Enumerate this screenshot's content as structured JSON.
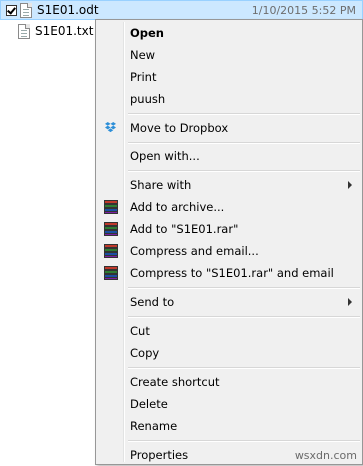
{
  "files": [
    {
      "name": "S1E01.odt",
      "date": "1/10/2015 5:52 PM",
      "selected": true
    },
    {
      "name": "S1E01.txt"
    }
  ],
  "menu": {
    "open": "Open",
    "new": "New",
    "print": "Print",
    "puush": "puush",
    "move_dropbox": "Move to Dropbox",
    "open_with": "Open with...",
    "share_with": "Share with",
    "add_archive": "Add to archive...",
    "add_rar": "Add to \"S1E01.rar\"",
    "compress_email": "Compress and email...",
    "compress_rar_email": "Compress to \"S1E01.rar\" and email",
    "send_to": "Send to",
    "cut": "Cut",
    "copy": "Copy",
    "create_shortcut": "Create shortcut",
    "delete": "Delete",
    "rename": "Rename",
    "properties": "Properties"
  },
  "watermark": "wsxdn.com",
  "colors": {
    "selection": "#cce8ff",
    "menu_bg": "#f0f0f0",
    "dropbox": "#2d8fd8"
  }
}
